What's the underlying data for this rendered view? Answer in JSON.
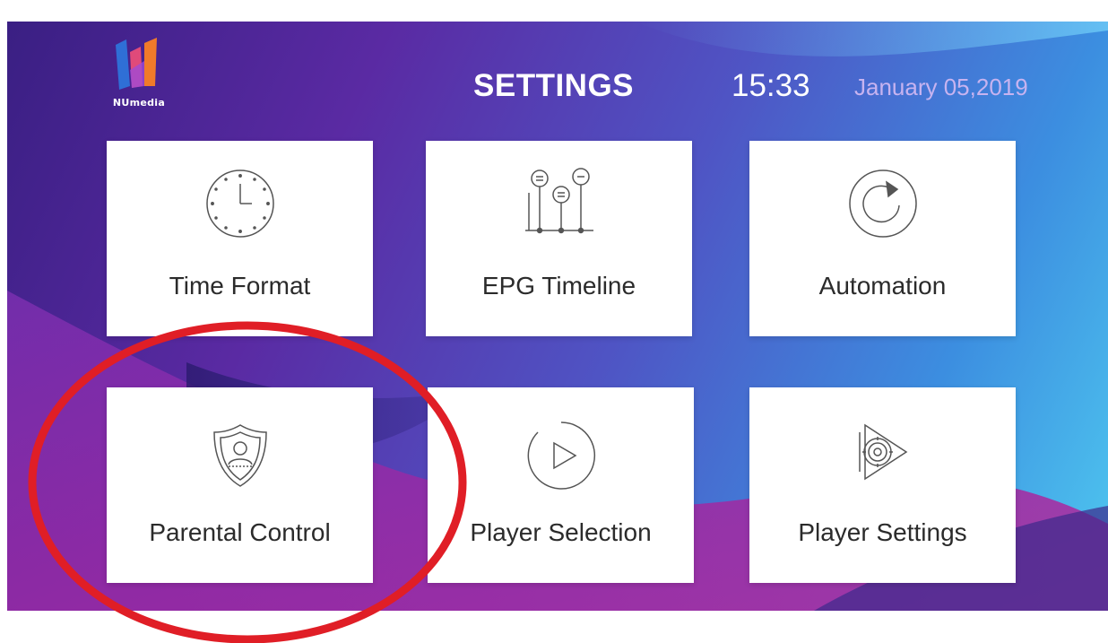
{
  "header": {
    "logo_text": "NUmedia",
    "title": "SETTINGS",
    "time": "15:33",
    "date": "January 05,2019"
  },
  "tiles": [
    {
      "label": "Time Format",
      "icon": "clock-icon"
    },
    {
      "label": "EPG Timeline",
      "icon": "timeline-icon"
    },
    {
      "label": "Automation",
      "icon": "refresh-icon"
    },
    {
      "label": "Parental Control",
      "icon": "shield-user-icon"
    },
    {
      "label": "Player Selection",
      "icon": "play-circle-icon"
    },
    {
      "label": "Player Settings",
      "icon": "player-gear-icon"
    }
  ],
  "colors": {
    "background_start": "#3a1f83",
    "background_end": "#4fc9f0",
    "tile": "#ffffff",
    "annotation": "#e01e26"
  }
}
